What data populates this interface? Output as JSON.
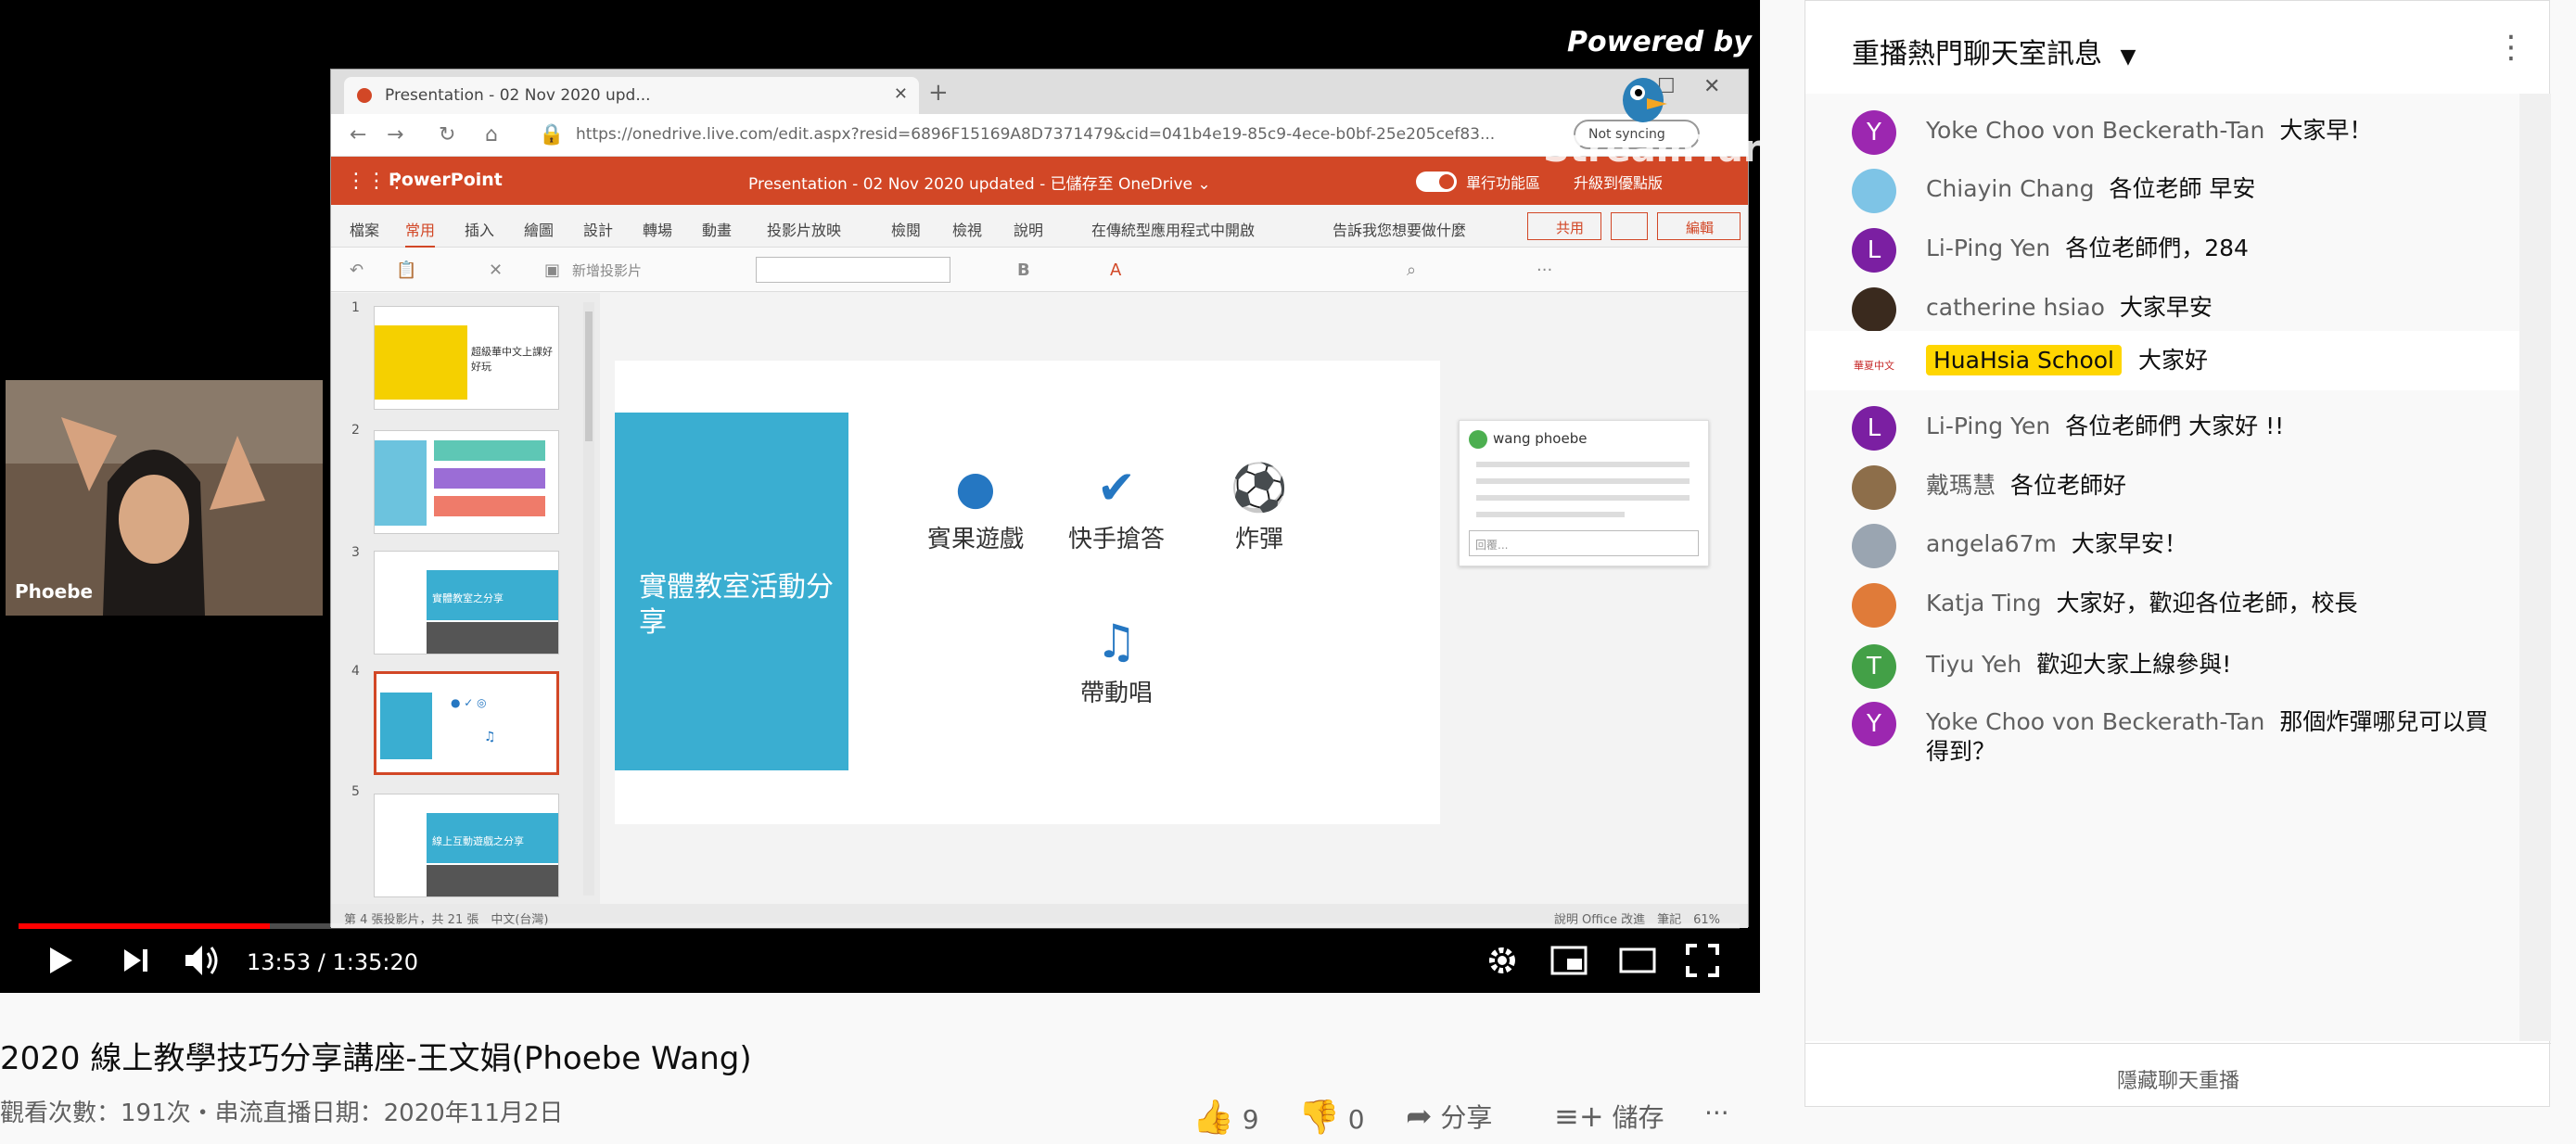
{
  "player": {
    "powered_by": "Powered by",
    "brand": "StreamYard",
    "browser": {
      "tab_title": "Presentation - 02 Nov 2020 upd...",
      "url": "https://onedrive.live.com/edit.aspx?resid=6896F15169A8D7371479&cid=041b4e19-85c9-4ece-b0bf-25e205cef83...",
      "not_syncing": "Not syncing"
    },
    "powerpoint": {
      "app_name": "PowerPoint",
      "doc_title": "Presentation - 02 Nov 2020 updated - 已儲存至 OneDrive ⌄",
      "classic": "單行功能區",
      "upgrade": "升級到優點版",
      "tabs": [
        "檔案",
        "常用",
        "插入",
        "繪圖",
        "設計",
        "轉場",
        "動畫",
        "投影片放映",
        "檢閱",
        "檢視",
        "說明",
        "在傳統型應用程式中開啟",
        "告訴我您想要做什麼"
      ],
      "share": "共用",
      "edit": "編輯",
      "new_slide": "新增投影片",
      "slide_numbers": [
        "1",
        "2",
        "3",
        "4",
        "5"
      ],
      "thumb_texts": [
        "超級華中文上課好好玩",
        "實體教室之分享",
        "線上互動遊戲之分享"
      ],
      "status_left": "第 4 張投影片，共 21 張　中文(台灣)",
      "status_right": "說明 Office 改進　筆記　61%"
    },
    "slide": {
      "title": "實體教室活動分享",
      "activities": [
        {
          "label": "賓果遊戲",
          "icon": "apple-icon"
        },
        {
          "label": "快手搶答",
          "icon": "check-icon"
        },
        {
          "label": "炸彈",
          "icon": "soccer-ball-icon"
        },
        {
          "label": "帶動唱",
          "icon": "music-note-icon"
        }
      ],
      "chat_popup_name": "wang phoebe",
      "chat_popup_input": "回覆..."
    },
    "camera_name": "Phoebe",
    "time": "13:53 / 1:35:20",
    "progress": 0.146,
    "accent": "#ff0000"
  },
  "video": {
    "title": "2020 線上教學技巧分享講座-王文娟(Phoebe Wang)",
    "meta": "觀看次數：191次・串流直播日期：2020年11月2日",
    "likes": "9",
    "dislikes": "0",
    "share": "分享",
    "save": "儲存",
    "more": "···"
  },
  "chat": {
    "title": "重播熱門聊天室訊息",
    "hide": "隱藏聊天重播",
    "messages": [
      {
        "author": "Yoke Choo von Beckerath-Tan",
        "text": "大家早！",
        "avatar": "Y",
        "color": "#9c27b0"
      },
      {
        "author": "Chiayin Chang",
        "text": "各位老師 早安",
        "avatar": "",
        "color": "#7ec4e6"
      },
      {
        "author": "Li-Ping Yen",
        "text": "各位老師們，284",
        "avatar": "L",
        "color": "#7b1fa2"
      },
      {
        "author": "catherine hsiao",
        "text": "大家早安",
        "avatar": "",
        "color": "#3a2a1e"
      },
      {
        "author": "HuaHsia School",
        "text": "大家好",
        "avatar": "華夏中文",
        "color": "#c62828",
        "owner": true
      },
      {
        "author": "Li-Ping Yen",
        "text": "各位老師們 大家好 !!",
        "avatar": "L",
        "color": "#7b1fa2"
      },
      {
        "author": "戴瑪慧",
        "text": "各位老師好",
        "avatar": "",
        "color": "#8d6e4a"
      },
      {
        "author": "angela67m",
        "text": "大家早安！",
        "avatar": "",
        "color": "#9aa5b1"
      },
      {
        "author": "Katja Ting",
        "text": "大家好，歡迎各位老師，校長",
        "avatar": "",
        "color": "#e07b39"
      },
      {
        "author": "Tiyu Yeh",
        "text": "歡迎大家上線參與!",
        "avatar": "T",
        "color": "#43a047"
      },
      {
        "author": "Yoke Choo von Beckerath-Tan",
        "text": "那個炸彈哪兒可以買得到？",
        "avatar": "Y",
        "color": "#9c27b0"
      }
    ]
  }
}
